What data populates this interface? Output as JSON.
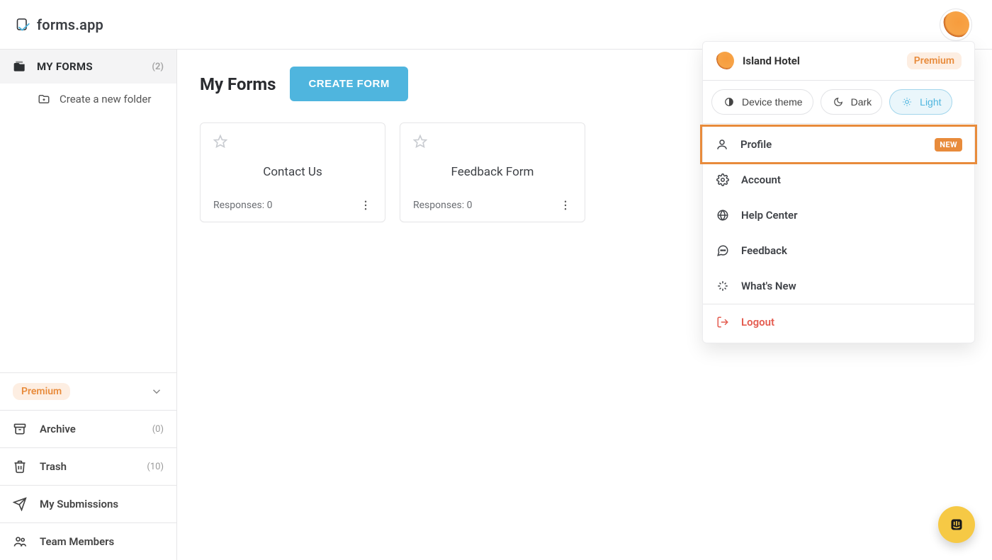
{
  "brand": {
    "name": "forms.app"
  },
  "sidebar": {
    "my_forms": {
      "label": "MY FORMS",
      "count": "(2)"
    },
    "create_folder_label": "Create a new folder",
    "premium_label": "Premium",
    "nav": {
      "archive": {
        "label": "Archive",
        "count": "(0)"
      },
      "trash": {
        "label": "Trash",
        "count": "(10)"
      },
      "my_submissions": {
        "label": "My Submissions"
      },
      "team_members": {
        "label": "Team Members"
      }
    }
  },
  "main": {
    "title": "My Forms",
    "create_button": "CREATE FORM",
    "cards": [
      {
        "title": "Contact Us",
        "responses": "Responses: 0"
      },
      {
        "title": "Feedback Form",
        "responses": "Responses: 0"
      }
    ]
  },
  "user_menu": {
    "name": "Island Hotel",
    "premium": "Premium",
    "themes": {
      "device": "Device theme",
      "dark": "Dark",
      "light": "Light"
    },
    "items": {
      "profile": {
        "label": "Profile",
        "badge": "NEW"
      },
      "account": {
        "label": "Account"
      },
      "help_center": {
        "label": "Help Center"
      },
      "feedback": {
        "label": "Feedback"
      },
      "whats_new": {
        "label": "What's New"
      },
      "logout": {
        "label": "Logout"
      }
    }
  }
}
